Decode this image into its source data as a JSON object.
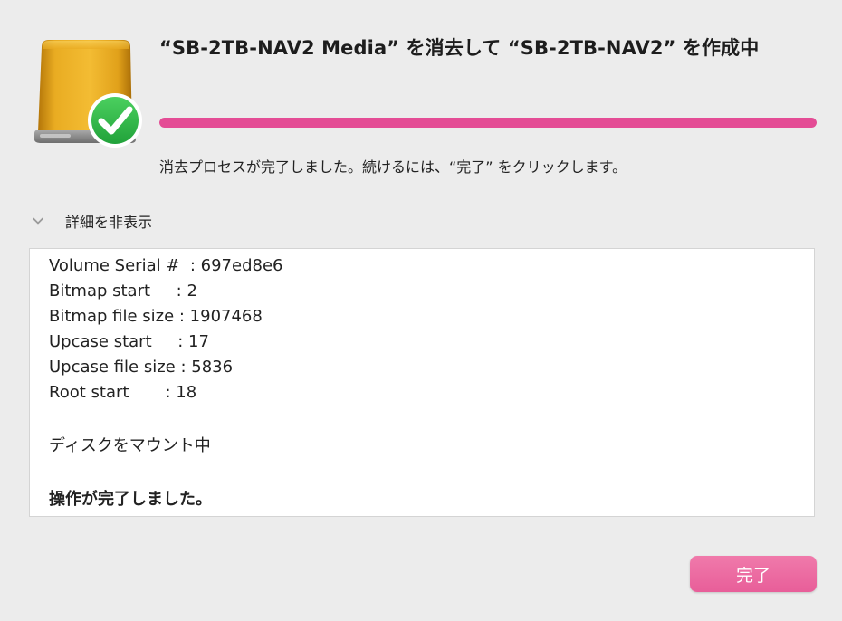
{
  "dialog": {
    "title": "“SB-2TB-NAV2 Media” を消去して “SB-2TB-NAV2” を作成中",
    "progress_fraction": 1.0,
    "status_text": "消去プロセスが完了しました。続けるには、“完了” をクリックします。",
    "details_toggle_label": "詳細を非表示",
    "icons": {
      "disk": "external-drive-icon",
      "badge": "checkmark-badge-icon",
      "toggle": "chevron-down-icon"
    },
    "log_lines": [
      "Volume Serial #  : 697ed8e6",
      "Bitmap start     : 2",
      "Bitmap file size : 1907468",
      "Upcase start     : 17",
      "Upcase file size : 5836",
      "Root start       : 18",
      "",
      "ディスクをマウント中",
      "",
      "操作が完了しました。"
    ],
    "done_button_label": "完了",
    "colors": {
      "accent": "#e44c95",
      "button": "#ea5f9b",
      "check_badge": "#2fb84a",
      "drive_body": "#e2a31b"
    }
  }
}
